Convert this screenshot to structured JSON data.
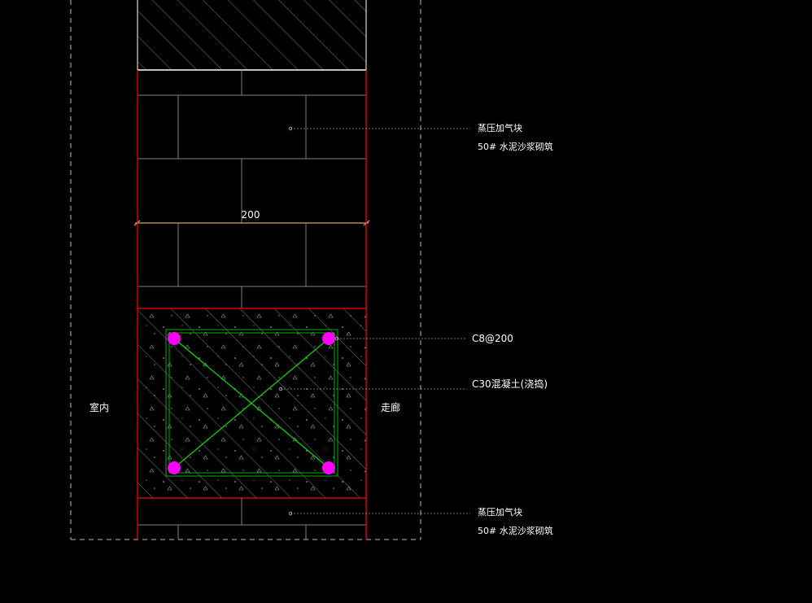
{
  "drawing": {
    "dimension_label": "200",
    "room_left": "室内",
    "room_right": "走廊",
    "callouts": {
      "top_line1": "蒸压加气块",
      "top_line2": "50# 水泥沙浆砌筑",
      "rebar": "C8@200",
      "concrete": "C30混凝土(浇捣)",
      "bottom_line1": "蒸压加气块",
      "bottom_line2": "50# 水泥沙浆砌筑"
    },
    "colors": {
      "background": "#000000",
      "wall_outline": "#ff0000",
      "stirrup": "#00c000",
      "diagonal": "#00ff00",
      "rebar_dot": "#ff00ff",
      "block_lines": "#808080",
      "hatch": "#9a9a9a"
    }
  }
}
